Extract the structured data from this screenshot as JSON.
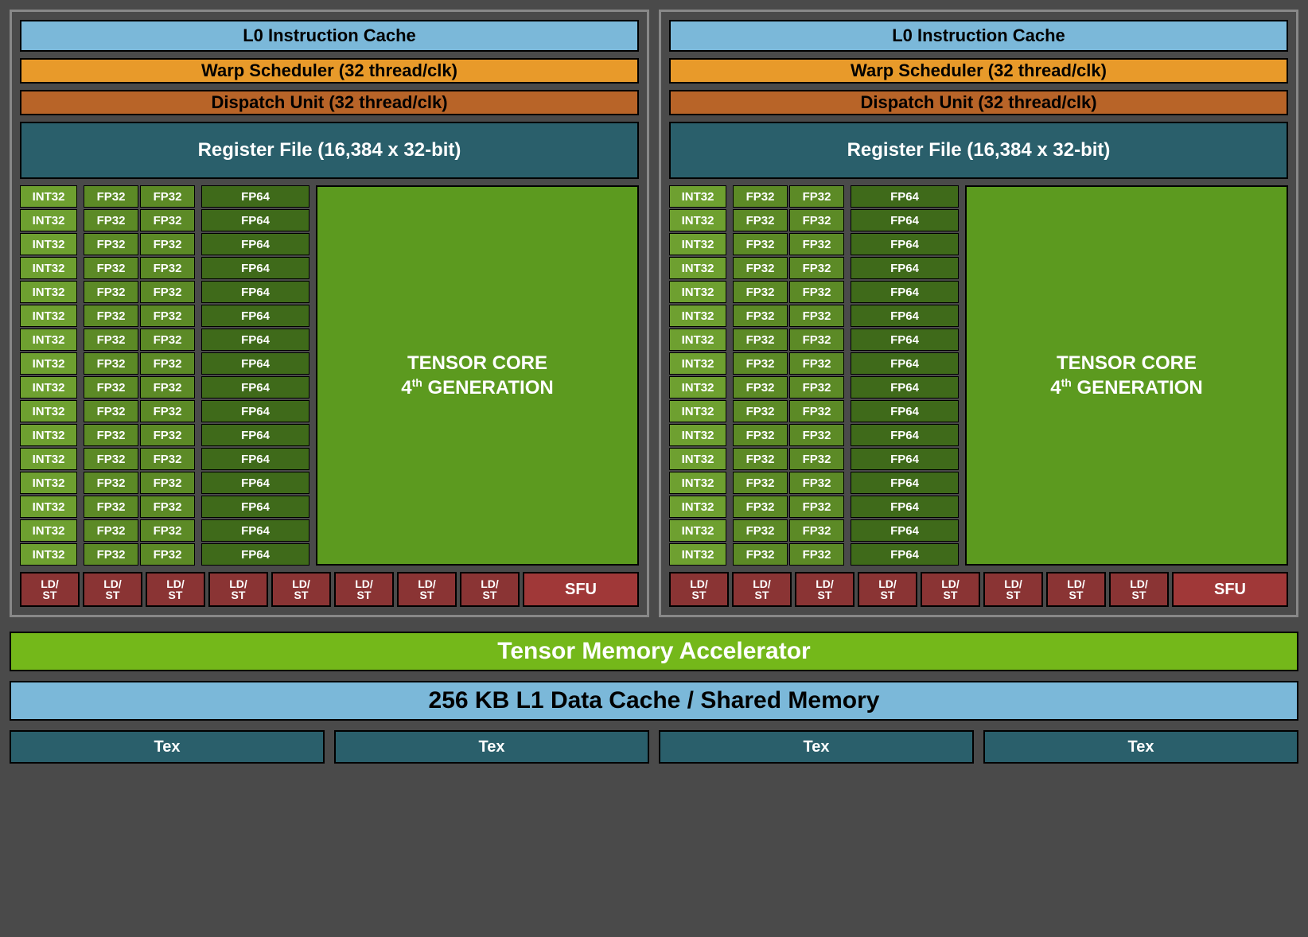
{
  "partition": {
    "l0cache": "L0 Instruction Cache",
    "warpsched": "Warp Scheduler (32 thread/clk)",
    "dispatch": "Dispatch Unit (32 thread/clk)",
    "regfile": "Register File (16,384 x 32-bit)",
    "int32": "INT32",
    "fp32": "FP32",
    "fp64": "FP64",
    "tensor_line1": "TENSOR CORE",
    "tensor_line2_pre": "4",
    "tensor_line2_sup": "th",
    "tensor_line2_post": " GENERATION",
    "ldst": "LD/\nST",
    "sfu": "SFU",
    "int32_rows": 16,
    "fp32_rows": 16,
    "fp64_rows": 16,
    "ldst_count": 8
  },
  "tma": "Tensor Memory Accelerator",
  "l1cache": "256 KB L1 Data Cache / Shared Memory",
  "tex": "Tex",
  "tex_count": 4,
  "partition_count": 2
}
